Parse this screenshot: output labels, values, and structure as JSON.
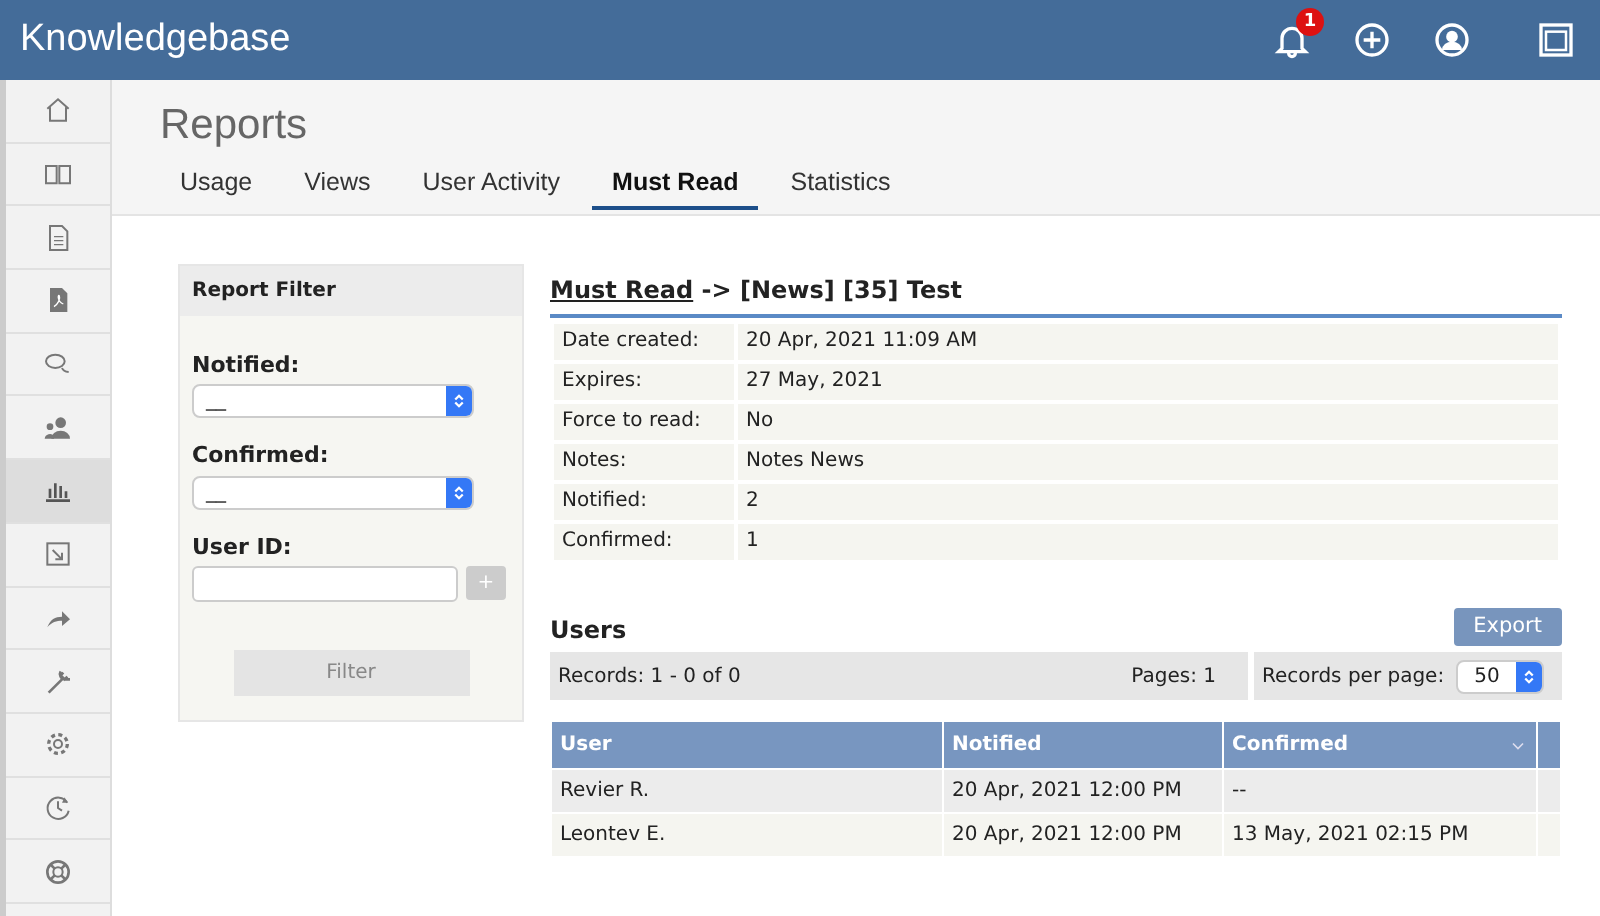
{
  "app": {
    "title": "Knowledgebase",
    "notification_count": "1"
  },
  "sidebar": {
    "items": [
      {
        "selected": false
      },
      {
        "selected": false
      },
      {
        "selected": false
      },
      {
        "selected": false
      },
      {
        "selected": false
      },
      {
        "selected": false
      },
      {
        "selected": true
      },
      {
        "selected": false
      },
      {
        "selected": false
      },
      {
        "selected": false
      },
      {
        "selected": false
      },
      {
        "selected": false
      },
      {
        "selected": false
      }
    ]
  },
  "page": {
    "title": "Reports"
  },
  "tabs": [
    {
      "label": "Usage",
      "selected": false
    },
    {
      "label": "Views",
      "selected": false
    },
    {
      "label": "User Activity",
      "selected": false
    },
    {
      "label": "Must Read",
      "selected": true
    },
    {
      "label": "Statistics",
      "selected": false
    }
  ],
  "filter": {
    "title": "Report Filter",
    "fields": [
      {
        "kind": "select",
        "label": "Notified:",
        "value": "__"
      },
      {
        "kind": "select",
        "label": "Confirmed:",
        "value": "__"
      },
      {
        "kind": "text",
        "label": "User ID:"
      }
    ],
    "add_button": {
      "label": "+",
      "disabled": true
    },
    "filter_button": {
      "label": "Filter",
      "disabled": true
    }
  },
  "detail": {
    "title_link": "Must Read",
    "title_rest": " -> [News] [35] Test",
    "fields": [
      {
        "label": "Date created:",
        "value": "20 Apr, 2021 11:09 AM"
      },
      {
        "label": "Expires:",
        "value": "27 May, 2021"
      },
      {
        "label": "Force to read:",
        "value": "No"
      },
      {
        "label": "Notes:",
        "value": "Notes News"
      },
      {
        "label": "Notified:",
        "value": "2"
      },
      {
        "label": "Confirmed:",
        "value": "1"
      }
    ]
  },
  "users": {
    "title": "Users",
    "export_button": "Export",
    "records": "Records: 1 - 0 of 0",
    "pages": "Pages: 1",
    "per_page_label": "Records per page:",
    "per_page": "50",
    "columns": [
      {
        "label": "User",
        "sorted": false
      },
      {
        "label": "Notified",
        "sorted": false
      },
      {
        "label": "Confirmed",
        "sorted": true
      }
    ],
    "rows": [
      [
        "Revier R.",
        "20 Apr, 2021 12:00 PM",
        "--"
      ],
      [
        "Leontev E.",
        "20 Apr, 2021 12:00 PM",
        "13 May, 2021 02:15 PM"
      ]
    ]
  }
}
